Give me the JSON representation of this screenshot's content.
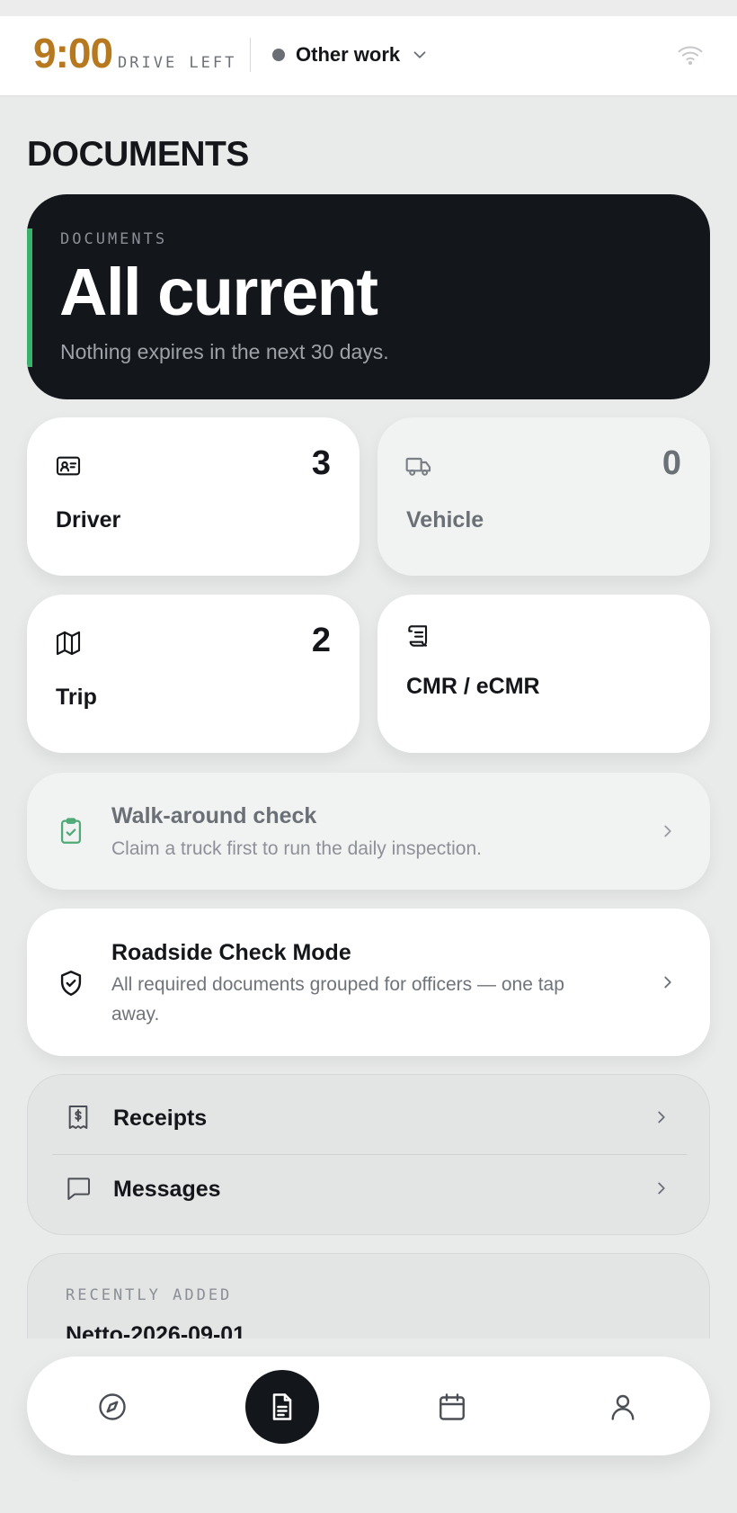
{
  "status_bar": {
    "drive_time": "9:00",
    "drive_label": "DRIVE LEFT",
    "status_text": "Other work",
    "status_dot_color": "#6b6f75"
  },
  "page": {
    "title": "DOCUMENTS"
  },
  "hero": {
    "eyebrow": "DOCUMENTS",
    "title": "All current",
    "subtitle": "Nothing expires in the next 30 days.",
    "accent_color": "#37b36b"
  },
  "tiles": [
    {
      "label": "Driver",
      "count": "3",
      "icon": "id-card-icon"
    },
    {
      "label": "Vehicle",
      "count": "0",
      "icon": "truck-icon"
    },
    {
      "label": "Trip",
      "count": "2",
      "icon": "map-icon"
    },
    {
      "label": "CMR / eCMR",
      "icon": "scroll-icon"
    }
  ],
  "walkaround": {
    "title": "Walk-around check",
    "subtitle": "Claim a truck first to run the daily inspection.",
    "icon": "clipboard-check-icon"
  },
  "roadside": {
    "title": "Roadside Check Mode",
    "subtitle": "All required documents grouped for officers — one tap away.",
    "icon": "shield-check-icon"
  },
  "links": [
    {
      "label": "Receipts",
      "icon": "receipt-icon"
    },
    {
      "label": "Messages",
      "icon": "message-icon"
    }
  ],
  "recent": {
    "eyebrow": "RECENTLY ADDED",
    "items": [
      "Netto-2026-09-01"
    ]
  },
  "tabbar": {
    "tabs": [
      {
        "icon": "compass-icon"
      },
      {
        "icon": "document-icon",
        "active": true
      },
      {
        "icon": "calendar-icon"
      },
      {
        "icon": "user-icon"
      }
    ]
  }
}
